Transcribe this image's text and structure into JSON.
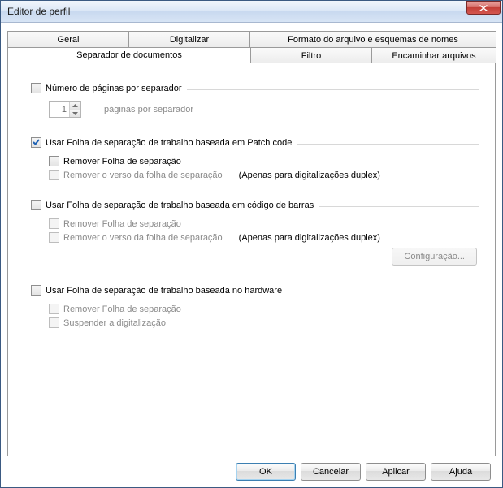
{
  "window": {
    "title": "Editor de perfil"
  },
  "tabs": {
    "row1": [
      "Geral",
      "Digitalizar",
      "Formato do arquivo e esquemas de nomes"
    ],
    "row2": [
      "Separador de documentos",
      "Filtro",
      "Encaminhar arquivos"
    ],
    "active": "Separador de documentos"
  },
  "sep_pages": {
    "title": "Número de páginas por separador",
    "value": "1",
    "unit": "páginas por separador"
  },
  "patch": {
    "title": "Usar Folha de separação de trabalho baseada em Patch code",
    "remove": "Remover Folha de separação",
    "remove_back": "Remover o verso da folha de separação",
    "note": "(Apenas para digitalizações duplex)"
  },
  "barcode": {
    "title": "Usar Folha de separação de trabalho baseada em código de barras",
    "remove": "Remover Folha de separação",
    "remove_back": "Remover o verso da folha de separação",
    "note": "(Apenas para digitalizações duplex)",
    "config": "Configuração..."
  },
  "hardware": {
    "title": "Usar Folha de separação de trabalho baseada no hardware",
    "remove": "Remover Folha de separação",
    "suspend": "Suspender a digitalização"
  },
  "buttons": {
    "ok": "OK",
    "cancel": "Cancelar",
    "apply": "Aplicar",
    "help": "Ajuda"
  }
}
